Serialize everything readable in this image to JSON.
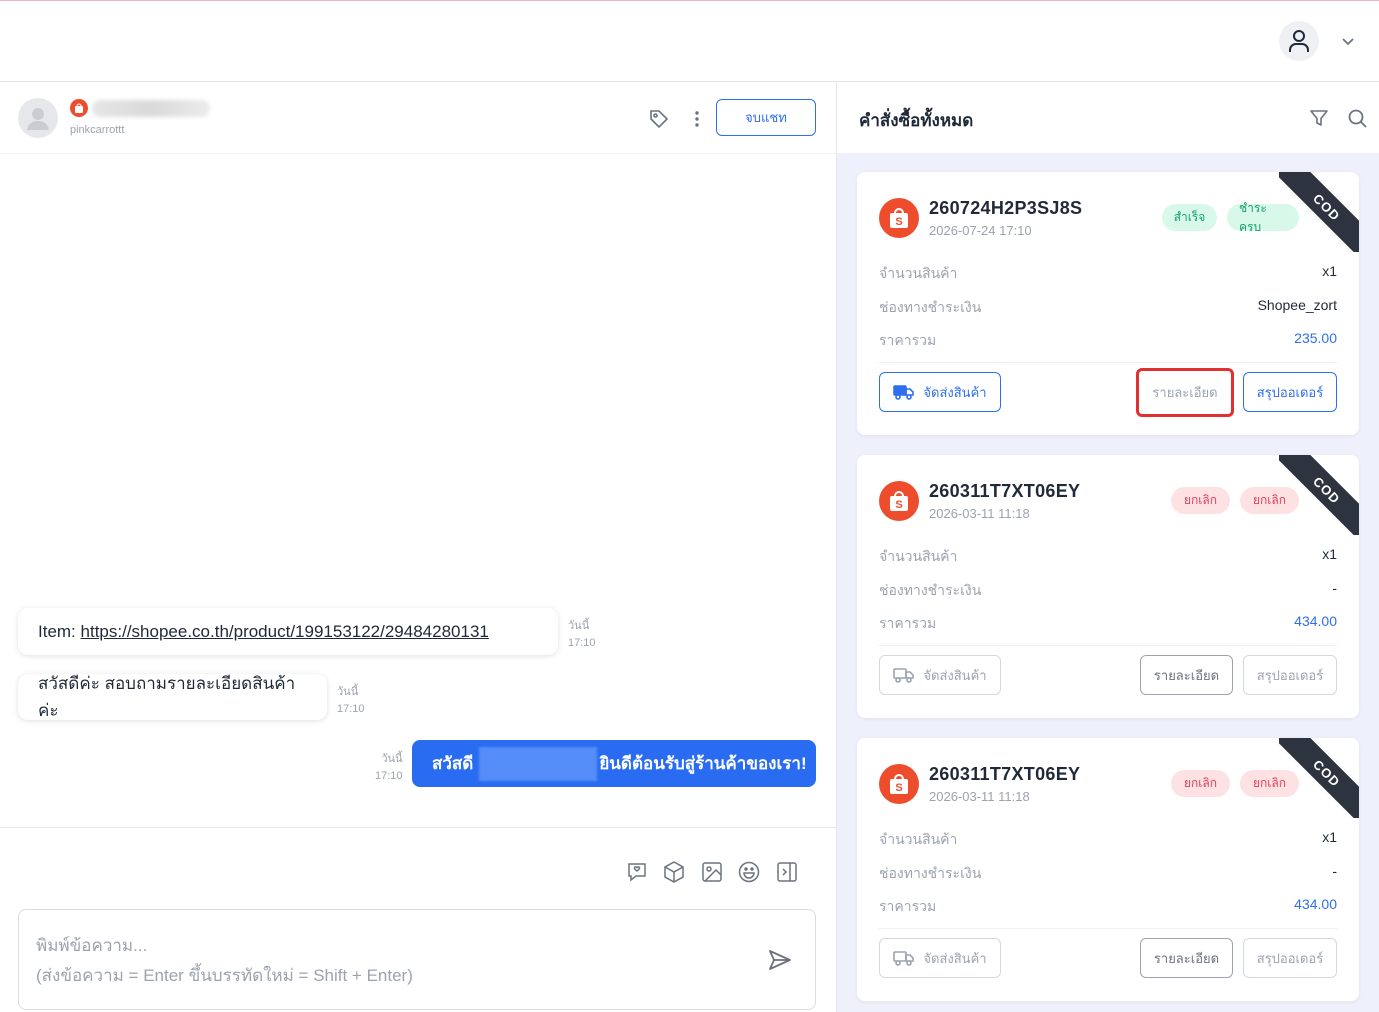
{
  "chat": {
    "contact_username": "pinkcarrottt",
    "end_chat_label": "จบแชท",
    "messages": [
      {
        "direction": "in",
        "prefix": "Item: ",
        "link": "https://shopee.co.th/product/199153122/29484280131",
        "day": "วันนี้",
        "time": "17:10"
      },
      {
        "direction": "in",
        "text": "สวัสดีค่ะ สอบถามรายละเอียดสินค้าค่ะ",
        "day": "วันนี้",
        "time": "17:10"
      },
      {
        "direction": "out",
        "text_before": "สวัสดี",
        "text_after": "ยินดีต้อนรับสู่ร้านค้าของเรา!",
        "day": "วันนี้",
        "time": "17:10"
      }
    ],
    "composer": {
      "placeholder_line1": "พิมพ์ข้อความ...",
      "placeholder_line2": "(ส่งข้อความ = Enter ขึ้นบรรทัดใหม่ = Shift + Enter)"
    }
  },
  "orders": {
    "title": "คำสั่งซื้อทั้งหมด",
    "labels": {
      "quantity": "จำนวนสินค้า",
      "payment_channel": "ช่องทางชำระเงิน",
      "total": "ราคารวม",
      "ship_button": "จัดส่งสินค้า",
      "detail_button": "รายละเอียด",
      "summary_button": "สรุปออเดอร์",
      "ribbon": "COD"
    },
    "cards": [
      {
        "id": "260724H2P3SJ8S",
        "date": "2026-07-24 17:10",
        "badges": [
          "สำเร็จ",
          "ชำระครบ"
        ],
        "badge_color": "green",
        "quantity": "x1",
        "payment": "Shopee_zort",
        "total": "235.00"
      },
      {
        "id": "260311T7XT06EY",
        "date": "2026-03-11 11:18",
        "badges": [
          "ยกเลิก",
          "ยกเลิก"
        ],
        "badge_color": "red",
        "quantity": "x1",
        "payment": "-",
        "total": "434.00"
      },
      {
        "id": "260311T7XT06EY",
        "date": "2026-03-11 11:18",
        "badges": [
          "ยกเลิก",
          "ยกเลิก"
        ],
        "badge_color": "red",
        "quantity": "x1",
        "payment": "-",
        "total": "434.00"
      }
    ]
  },
  "colors": {
    "accent": "#2f6fed",
    "shopee": "#ee4d2d",
    "highlight": "#e0302f",
    "ribbon": "#2d3440"
  }
}
